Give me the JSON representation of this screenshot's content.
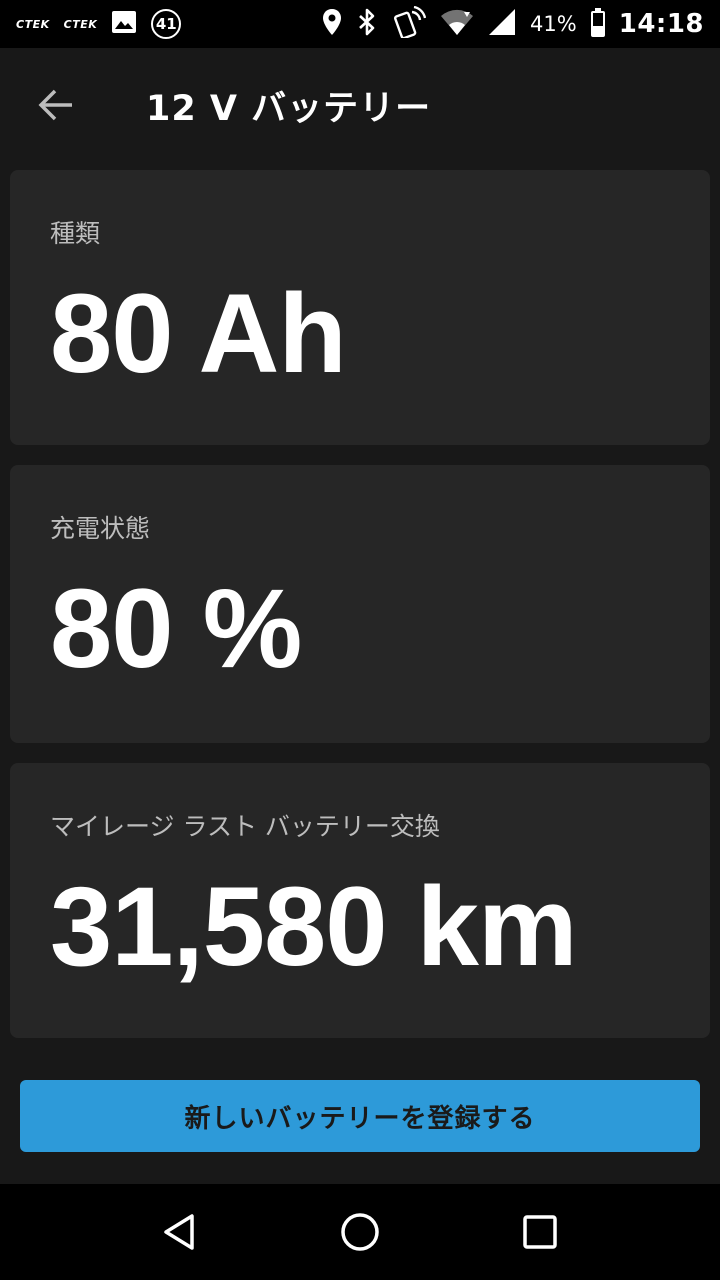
{
  "status_bar": {
    "notif_ctek_1": "CTEK",
    "notif_ctek_2": "CTEK",
    "notif_count": "41",
    "battery_percent": "41%",
    "battery_level": 0.41,
    "time": "14:18"
  },
  "header": {
    "title": "12 V バッテリー",
    "back_icon": "arrow-left-icon"
  },
  "cards": [
    {
      "label": "種類",
      "value": "80 Ah"
    },
    {
      "label": "充電状態",
      "value": "80 %"
    },
    {
      "label": "マイレージ ラスト バッテリー交換",
      "value": "31,580 km"
    }
  ],
  "primary_action": {
    "label": "新しいバッテリーを登録する"
  },
  "nav_bar": {
    "icons": [
      "back-triangle-icon",
      "home-circle-icon",
      "recents-square-icon"
    ]
  },
  "colors": {
    "background": "#181818",
    "card": "#262626",
    "accent": "#2d9ad9",
    "label": "#bdbdbd"
  }
}
